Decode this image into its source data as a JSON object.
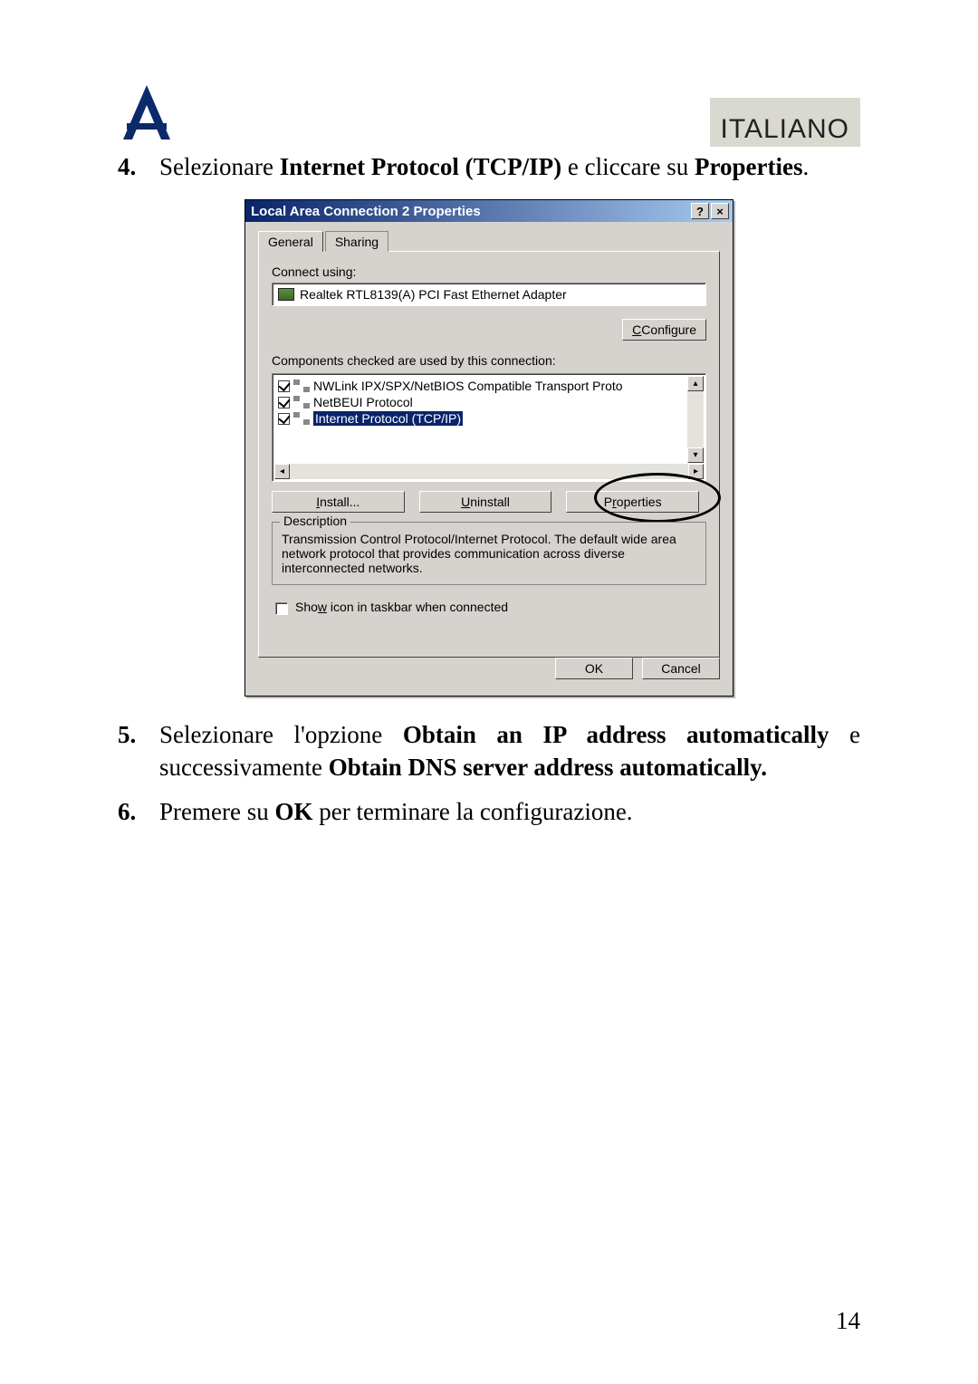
{
  "header": {
    "language": "ITALIANO"
  },
  "instructions": {
    "i4_num": "4.",
    "i4_pre": "Selezionare ",
    "i4_b1": "Internet Protocol (TCP/IP)",
    "i4_mid": " e cliccare su ",
    "i4_b2": "Properties",
    "i4_end": ".",
    "i5_num": "5.",
    "i5_pre": "Selezionare l'opzione ",
    "i5_b1": "Obtain an IP address automatically",
    "i5_mid": " e successivamente ",
    "i5_b2": "Obtain DNS server address automatically.",
    "i6_num": "6.",
    "i6_pre": "Premere su  ",
    "i6_b1": "OK",
    "i6_end": " per terminare la configurazione."
  },
  "dialog": {
    "title": "Local Area Connection 2 Properties",
    "help_btn": "?",
    "close_btn": "×",
    "tabs": {
      "general": "General",
      "sharing": "Sharing"
    },
    "connect_using_label": "Connect using:",
    "adapter": "Realtek RTL8139(A) PCI Fast Ethernet Adapter",
    "configure_btn": "Configure",
    "configure_u": "C",
    "components_label": "Components checked are used by this connection:",
    "list": {
      "row0": "NWLink IPX/SPX/NetBIOS Compatible Transport Proto",
      "row1": "NetBEUI Protocol",
      "row2": "Internet Protocol (TCP/IP)"
    },
    "install_btn": "nstall...",
    "install_u": "I",
    "uninstall_btn": "ninstall",
    "uninstall_u": "U",
    "properties_btn": "roperties",
    "properties_u": "P",
    "desc_label": "Description",
    "desc_text": "Transmission Control Protocol/Internet Protocol. The default wide area network protocol that provides communication across diverse interconnected networks.",
    "show_pre": "Sho",
    "show_u": "w",
    "show_post": " icon in taskbar when connected",
    "ok_btn": "OK",
    "cancel_btn": "Cancel"
  },
  "page_number": "14"
}
